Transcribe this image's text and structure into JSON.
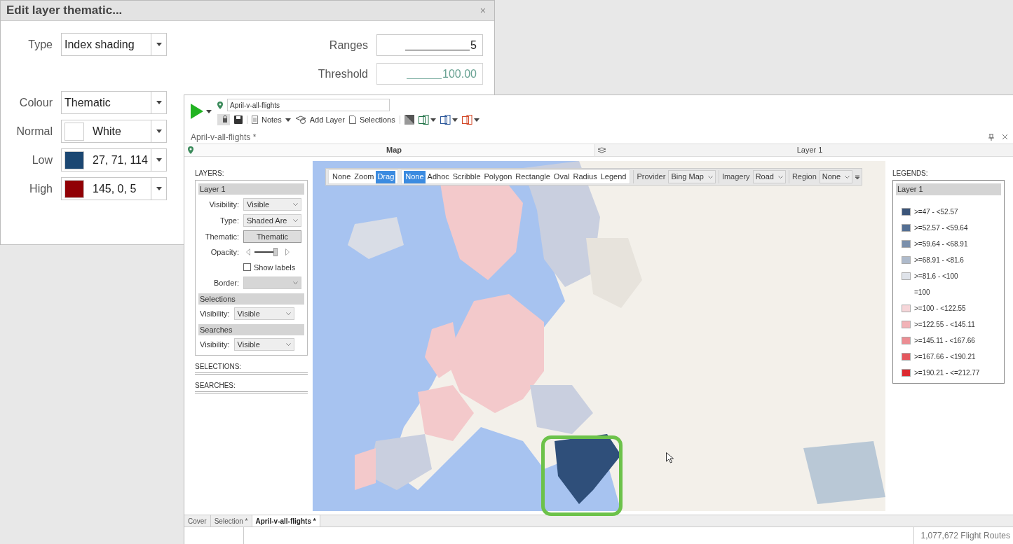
{
  "dialog": {
    "title": "Edit layer thematic...",
    "close": "×",
    "type_field": {
      "label": "Type",
      "value": "Index shading"
    },
    "colour_fields": [
      {
        "label": "Colour",
        "value": "Thematic"
      },
      {
        "label": "Normal",
        "value": "White",
        "color": "#ffffff"
      },
      {
        "label": "Low",
        "value": "27, 71, 114",
        "color": "#1b4772"
      },
      {
        "label": "High",
        "value": "145, 0, 5",
        "color": "#910005"
      }
    ],
    "number_fields": [
      {
        "label": "Ranges",
        "value": "5",
        "disabled": false
      },
      {
        "label": "Threshold",
        "value": "100.00",
        "disabled": true
      }
    ]
  },
  "app": {
    "search": "April-v-all-flights",
    "toolbar": [
      {
        "label": "Notes",
        "kind": "menu"
      },
      {
        "label": "Add Layer",
        "kind": "layer"
      },
      {
        "label": "Selections",
        "kind": "page"
      }
    ],
    "doc_title": "April-v-all-flights *",
    "panes": [
      {
        "title": "Map"
      },
      {
        "title": "Layer 1"
      }
    ],
    "layers": {
      "heading": "LAYERS:",
      "layer": "Layer 1",
      "rows": [
        {
          "kind": "select",
          "label": "Visibility:",
          "value": "Visible"
        },
        {
          "kind": "select",
          "label": "Type:",
          "value": "Shaded Are"
        },
        {
          "kind": "button",
          "label": "Thematic:",
          "value": "Thematic"
        },
        {
          "kind": "slider",
          "label": "Opacity:",
          "level": 0.8
        },
        {
          "kind": "checkbox",
          "value": "Show labels",
          "checked": false
        },
        {
          "kind": "select",
          "label": "Border:",
          "disabled": true
        }
      ],
      "sections": [
        {
          "title": "Selections",
          "label": "Visibility:",
          "value": "Visible"
        },
        {
          "title": "Searches",
          "label": "Visibility:",
          "value": "Visible"
        }
      ],
      "footers": [
        "SELECTIONS:",
        "SEARCHES:"
      ]
    },
    "map_toolbar": {
      "modes": [
        {
          "label": "None",
          "selected": false
        },
        {
          "label": "Zoom",
          "selected": false
        },
        {
          "label": "Drag",
          "selected": true
        }
      ],
      "tools": [
        {
          "label": "None",
          "selected": true
        },
        {
          "label": "Adhoc",
          "selected": false
        },
        {
          "label": "Scribble",
          "selected": false
        },
        {
          "label": "Polygon",
          "selected": false
        },
        {
          "label": "Rectangle",
          "selected": false
        },
        {
          "label": "Oval",
          "selected": false
        },
        {
          "label": "Radius",
          "selected": false
        },
        {
          "label": "Legend",
          "selected": false
        }
      ],
      "dropdowns": [
        {
          "label": "Provider",
          "value": "Bing Map"
        },
        {
          "label": "Imagery",
          "value": "Road"
        },
        {
          "label": "Region",
          "value": "None"
        }
      ]
    },
    "legend": {
      "heading": "LEGENDS:",
      "layer": "Layer 1",
      "items": [
        {
          "label": ">=47 - <52.57",
          "color": "#3b5478"
        },
        {
          "label": ">=52.57 - <59.64",
          "color": "#546f93"
        },
        {
          "label": ">=59.64 - <68.91",
          "color": "#7a8fab"
        },
        {
          "label": ">=68.91 - <81.6",
          "color": "#aebacb"
        },
        {
          "label": ">=81.6 - <100",
          "color": "#dfe3ea"
        },
        {
          "label": "=100"
        },
        {
          "label": ">=100 - <122.55",
          "color": "#f6d6d9"
        },
        {
          "label": ">=122.55 - <145.11",
          "color": "#f2b3b7"
        },
        {
          "label": ">=145.11 - <167.66",
          "color": "#ec8d93"
        },
        {
          "label": ">=167.66 - <190.21",
          "color": "#e5575e"
        },
        {
          "label": ">=190.21 - <=212.77",
          "color": "#dc2a30"
        }
      ]
    },
    "tabs": [
      {
        "label": "Cover",
        "selected": false
      },
      {
        "label": "Selection *",
        "selected": false
      },
      {
        "label": "April-v-all-flights *",
        "selected": true
      }
    ],
    "status": "1,077,672 Flight Routes"
  }
}
